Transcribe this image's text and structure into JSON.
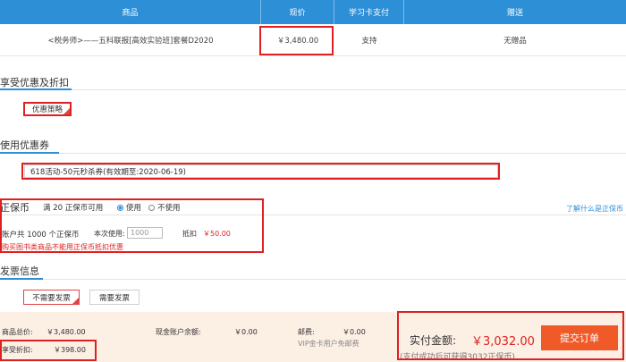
{
  "table": {
    "headers": [
      "商品",
      "现价",
      "学习卡支付",
      "赠送"
    ],
    "row": {
      "name": "<税务师>——五科联报[高效实验班]套餐D2020",
      "price": "￥3,480.00",
      "card_pay": "支持",
      "gift": "无赠品"
    }
  },
  "discount": {
    "title": "享受优惠及折扣",
    "option": "优惠策略"
  },
  "coupon": {
    "title": "使用优惠券",
    "selected": "618活动-50元秒杀券(有效期至:2020-06-19)"
  },
  "coin": {
    "title": "正保币",
    "rule": "满 20 正保币可用",
    "use_label": "使用",
    "no_use_label": "不使用",
    "help_link": "了解什么是正保币",
    "account_total": "账户共 1000 个正保币",
    "this_use_label": "本次使用:",
    "this_use_value": "1000",
    "deduct_label": "抵扣",
    "deduct_value": "￥50.00",
    "note": "购买图书类商品不能用正保币抵扣优惠"
  },
  "invoice": {
    "title": "发票信息",
    "no_invoice": "不需要发票",
    "need_invoice": "需要发票"
  },
  "summary": {
    "total_label": "商品总价:",
    "total_value": "￥3,480.00",
    "balance_label": "现金账户余额:",
    "balance_value": "￥0.00",
    "postage_label": "邮费:",
    "postage_value": "￥0.00",
    "vip_note": "VIP金卡用户免邮费",
    "discount_label": "享受折扣:",
    "discount_value": "￥398.00",
    "pay_label": "实付金额:",
    "pay_value": "￥3,032.00",
    "reward_note": "(支付成功后可获得3032正保币)",
    "submit": "提交订单"
  },
  "colors": {
    "accent": "#2d8fd6",
    "danger": "#e02020",
    "submit": "#f05a28"
  }
}
